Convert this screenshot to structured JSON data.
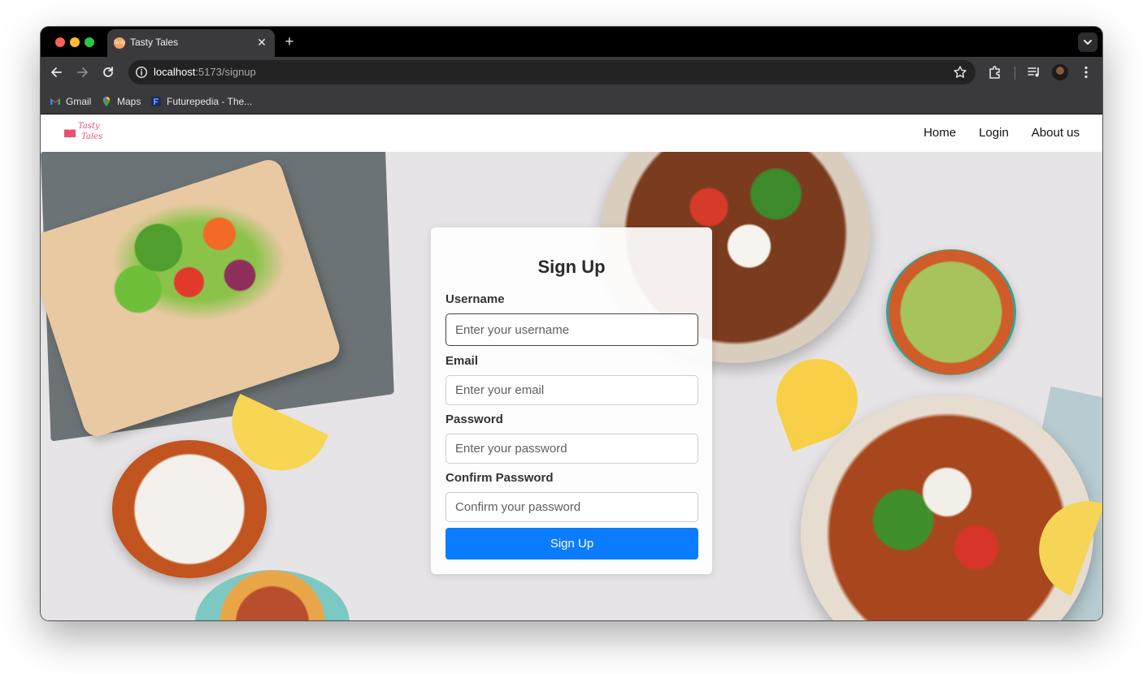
{
  "browser": {
    "tab_title": "Tasty Tales",
    "tab_favicon_text": "Tasty",
    "url_host": "localhost",
    "url_path": ":5173/signup",
    "bookmarks": [
      "Gmail",
      "Maps",
      "Futurepedia - The..."
    ]
  },
  "site": {
    "logo_line1": "Tasty",
    "logo_line2": "Tales",
    "nav": [
      "Home",
      "Login",
      "About us"
    ],
    "accent_color": "#0b7cfd",
    "logo_color": "#e8506f"
  },
  "form": {
    "title": "Sign Up",
    "username_label": "Username",
    "username_placeholder": "Enter your username",
    "email_label": "Email",
    "email_placeholder": "Enter your email",
    "password_label": "Password",
    "password_placeholder": "Enter your password",
    "confirm_label": "Confirm Password",
    "confirm_placeholder": "Confirm your password",
    "submit_label": "Sign Up"
  },
  "icons": [
    "back-icon",
    "forward-icon",
    "reload-icon",
    "info-icon",
    "star-icon",
    "extensions-icon",
    "media-icon",
    "profile-avatar",
    "more-icon",
    "close-icon",
    "plus-icon",
    "chevron-down-icon"
  ]
}
